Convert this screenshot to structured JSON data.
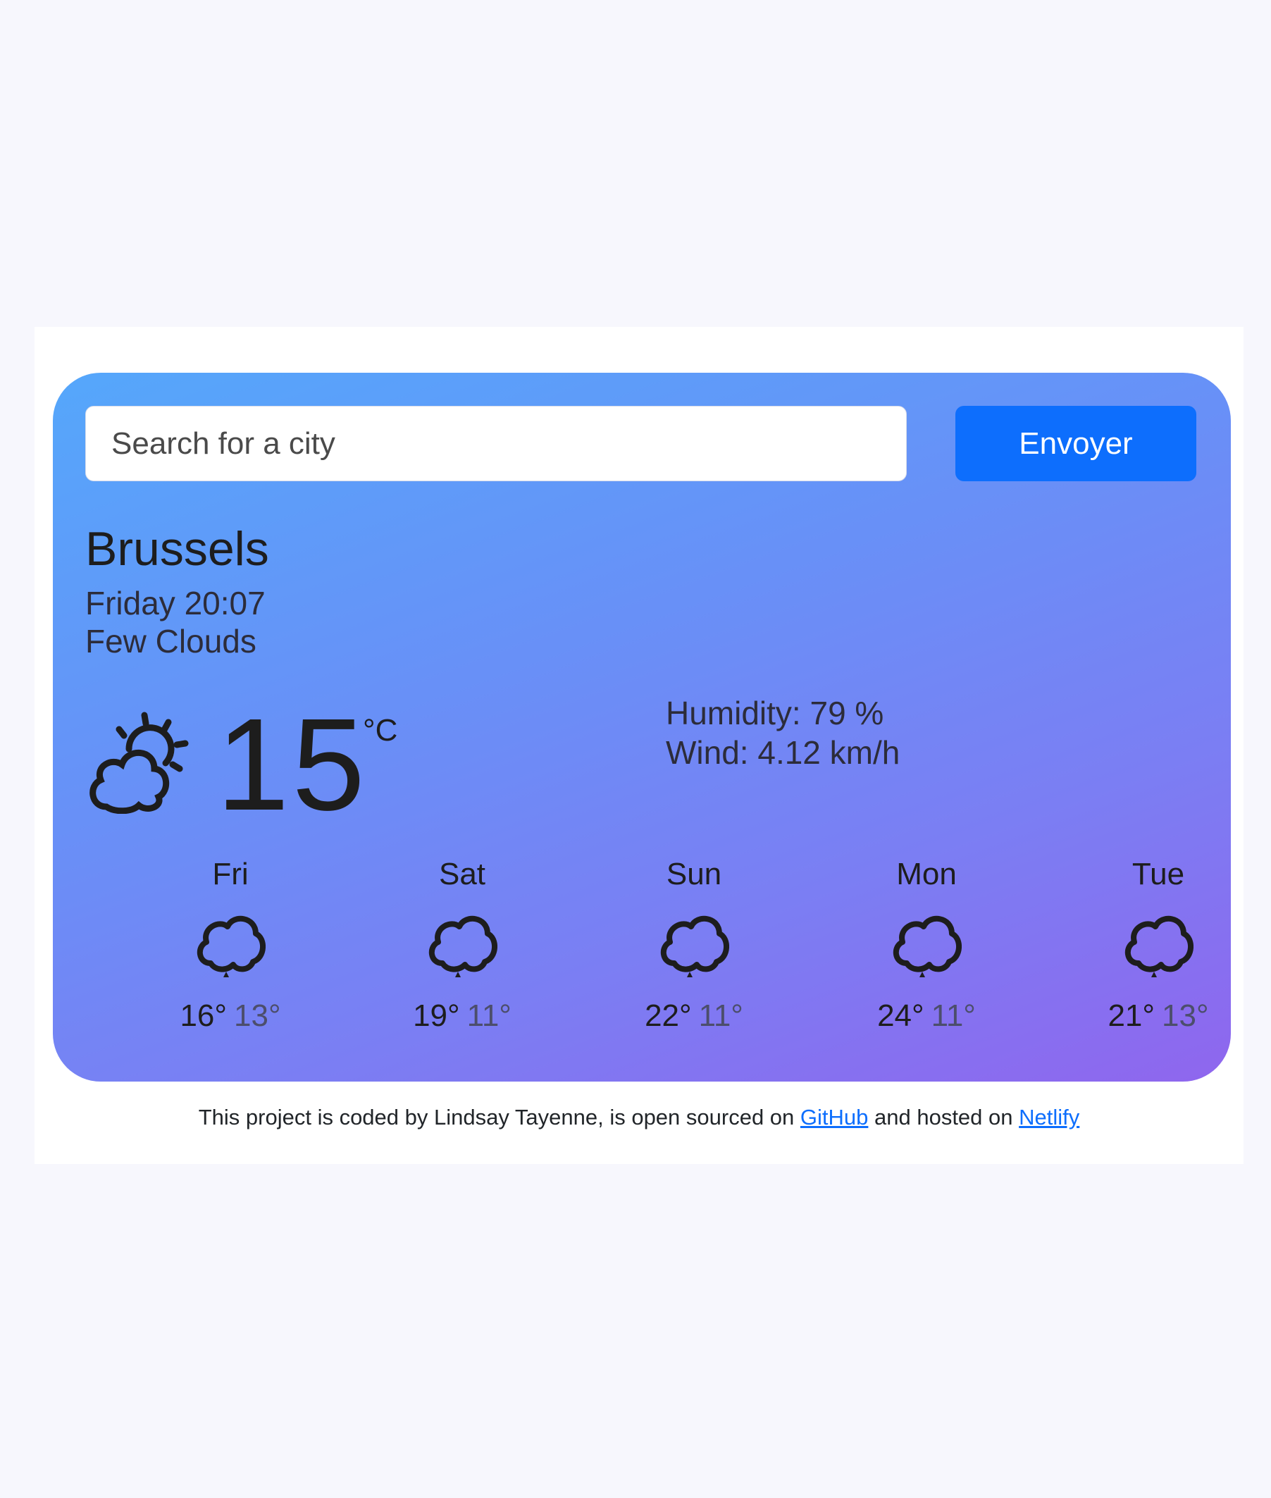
{
  "search": {
    "placeholder": "Search for a city",
    "button_label": "Envoyer"
  },
  "current": {
    "city": "Brussels",
    "datetime": "Friday 20:07",
    "description": "Few Clouds",
    "icon": "cloud-sun-icon",
    "temperature": "15",
    "unit": "°C",
    "humidity": "Humidity: 79 %",
    "wind": "Wind: 4.12 km/h"
  },
  "forecast": [
    {
      "day": "Fri",
      "icon": "cloud-rain-icon",
      "max": "16°",
      "min": "13°"
    },
    {
      "day": "Sat",
      "icon": "cloud-rain-icon",
      "max": "19°",
      "min": "11°"
    },
    {
      "day": "Sun",
      "icon": "cloud-rain-icon",
      "max": "22°",
      "min": "11°"
    },
    {
      "day": "Mon",
      "icon": "cloud-rain-icon",
      "max": "24°",
      "min": "11°"
    },
    {
      "day": "Tue",
      "icon": "cloud-rain-icon",
      "max": "21°",
      "min": "13°"
    }
  ],
  "footer": {
    "prefix": "This project is coded by Lindsay Tayenne, is open sourced on ",
    "github_link": "GitHub",
    "middle": " and hosted on ",
    "netlify_link": "Netlify"
  },
  "colors": {
    "page_background": "#f7f7fd",
    "gradient_start": "#55a7fb",
    "gradient_end": "#8f66ee",
    "button": "#0d6efd",
    "link": "#0d6efd"
  }
}
